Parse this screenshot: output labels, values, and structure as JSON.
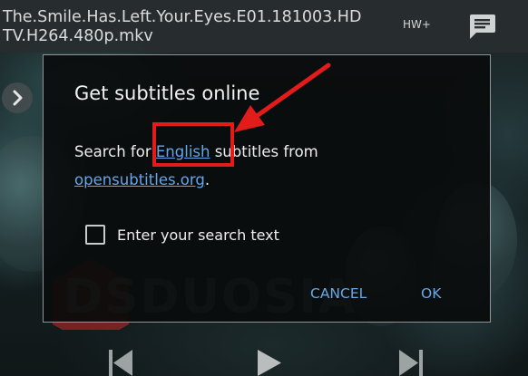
{
  "player": {
    "file_title": "The.Smile.Has.Left.Your.Eyes.E01.181003.​HDTV.H264.480p.mkv",
    "hw_badge": "HW+",
    "subtitle_icon": "subtitle-message-icon",
    "side_arrow_icon": "chevron-right-icon"
  },
  "dialog": {
    "title": "Get subtitles online",
    "body_prefix": "Search for ",
    "language_link": "English",
    "body_middle": " subtitles from ",
    "source_link": "opensubtitles.org",
    "body_suffix": ".",
    "checkbox_label": "Enter your search text",
    "checkbox_checked": false,
    "cancel_label": "CANCEL",
    "ok_label": "OK"
  },
  "controls": {
    "previous_icon": "skip-previous-icon",
    "play_icon": "play-icon",
    "next_icon": "skip-next-icon"
  },
  "watermark": {
    "text": "DSDUOSIA"
  },
  "colors": {
    "link": "#64a6e8",
    "annotation": "#e21b1b",
    "dialog_bg": "#0a0c0c"
  }
}
